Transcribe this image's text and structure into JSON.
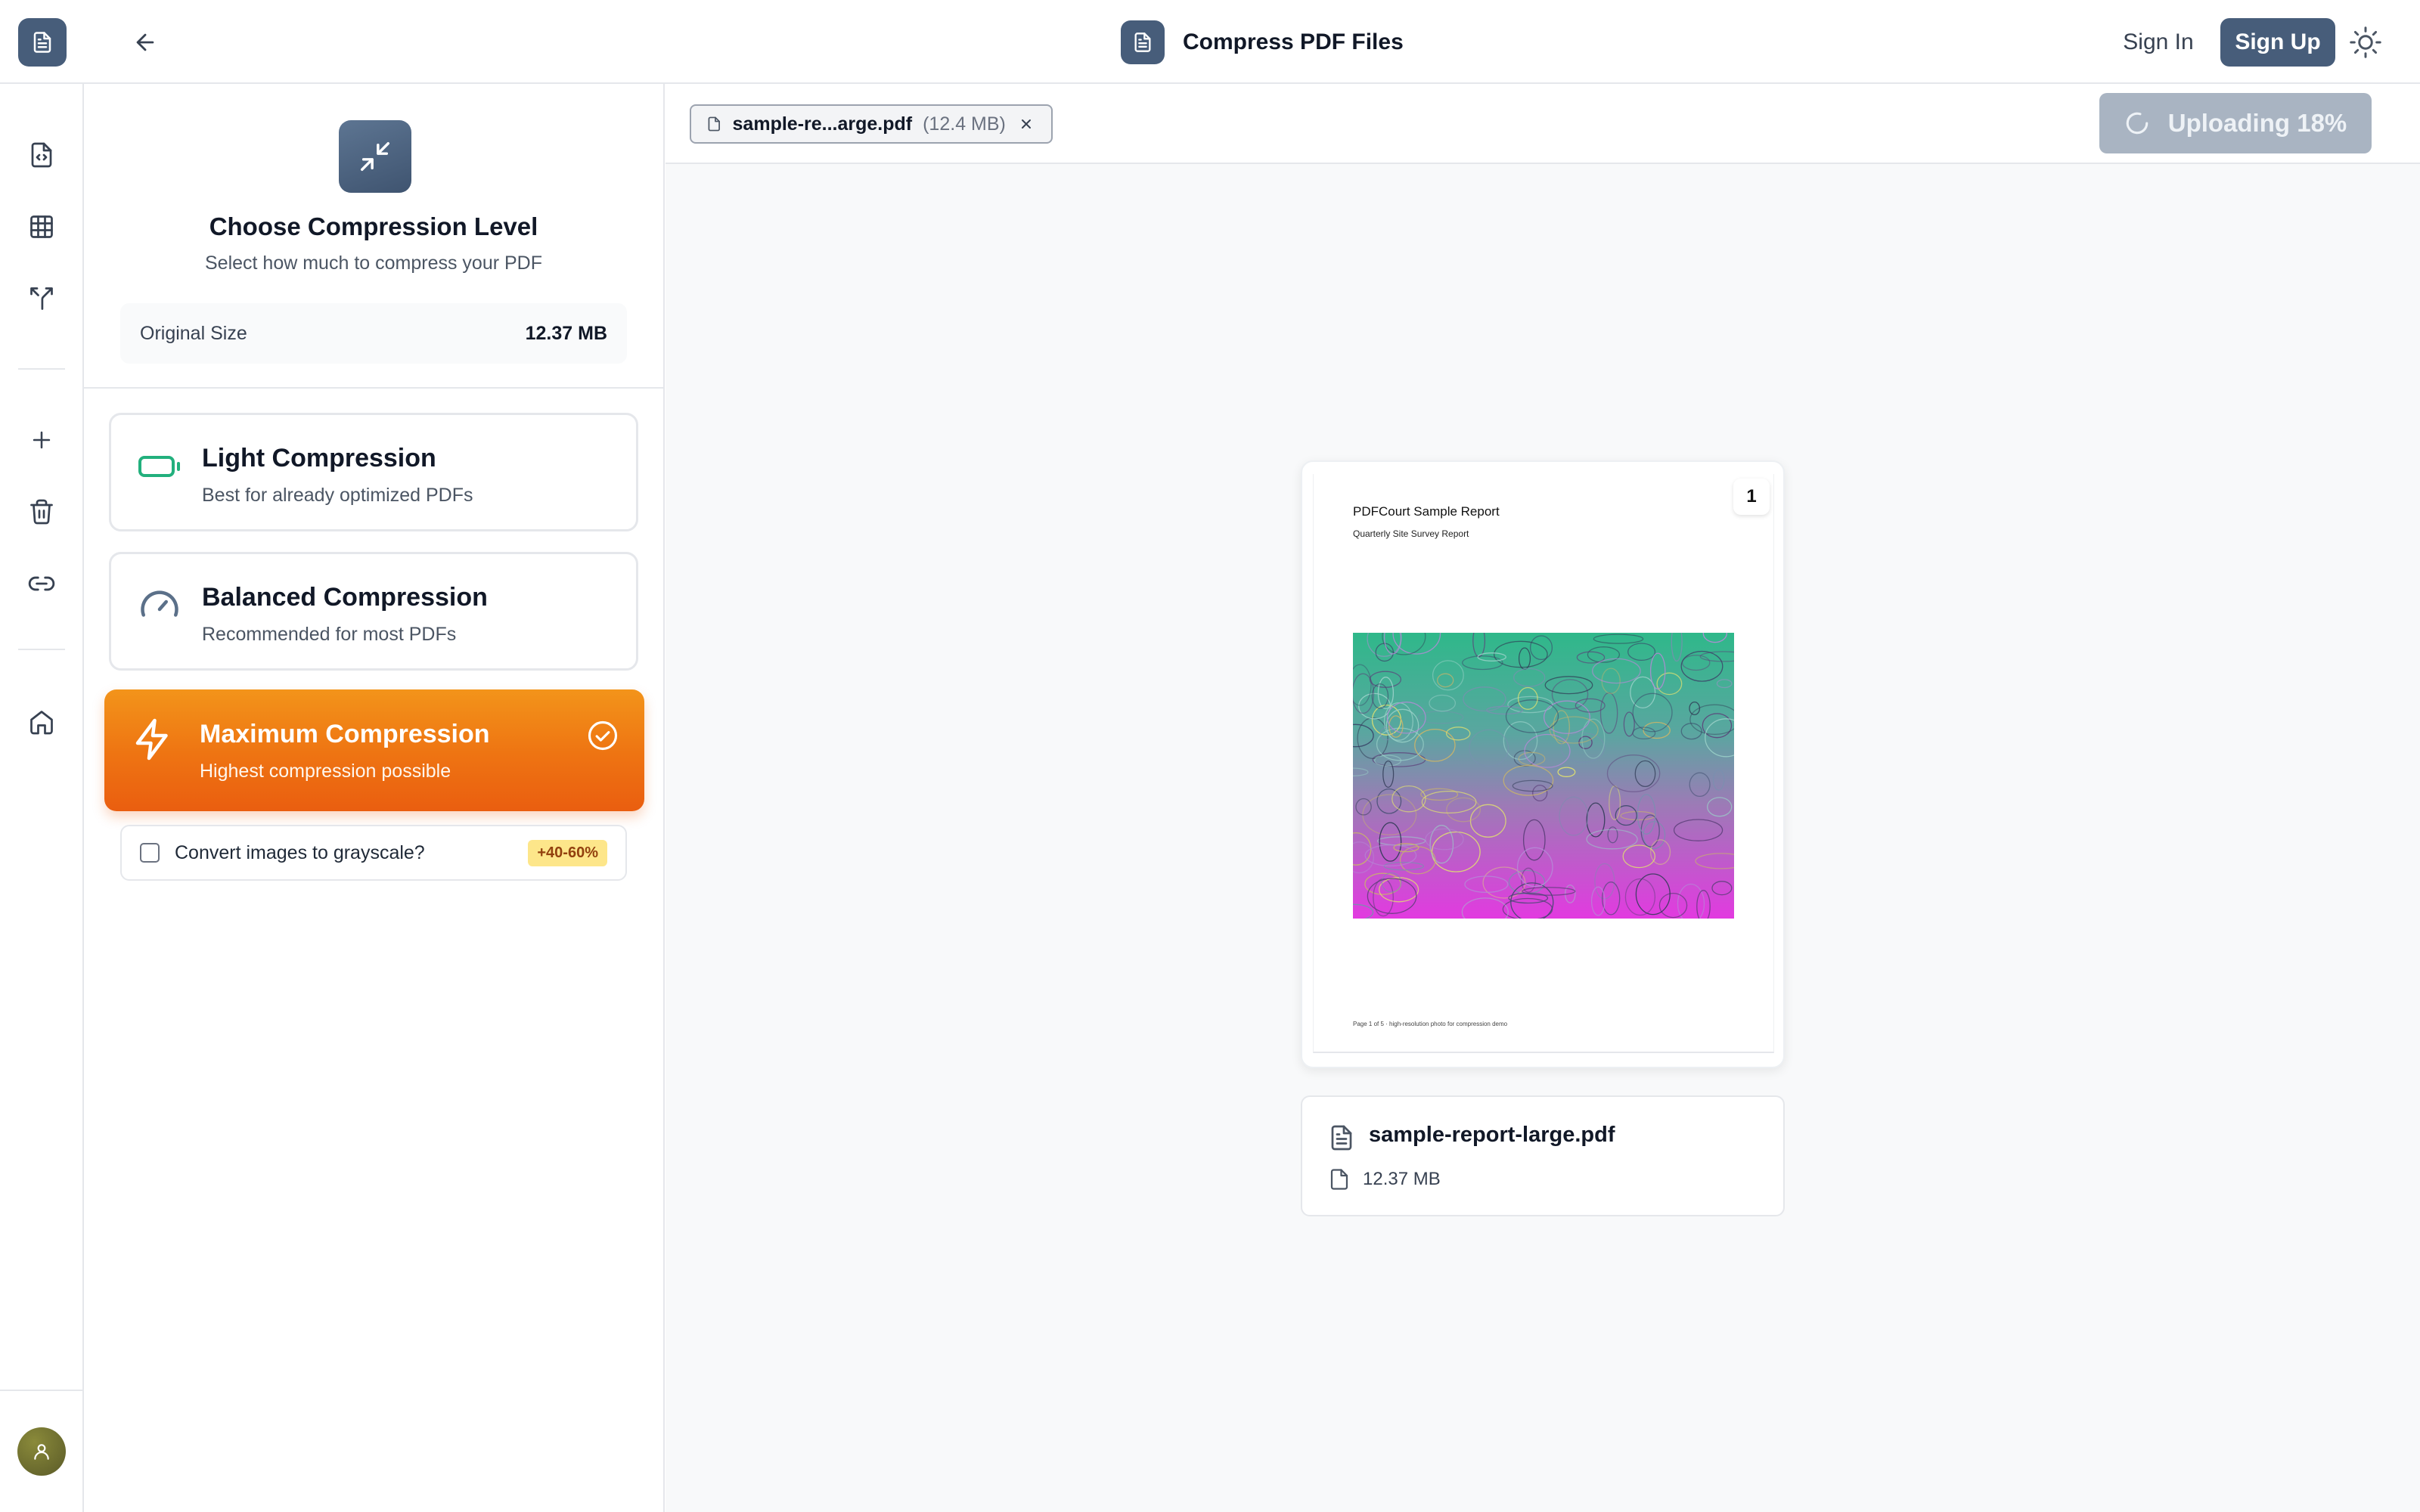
{
  "header": {
    "title": "Compress PDF Files",
    "sign_in": "Sign In",
    "sign_up": "Sign Up"
  },
  "sidebar": {
    "items": [
      {
        "icon": "file-code-icon"
      },
      {
        "icon": "grid-icon"
      },
      {
        "icon": "merge-arrows-icon"
      },
      {
        "icon": "plus-icon"
      },
      {
        "icon": "trash-icon"
      },
      {
        "icon": "link-icon"
      },
      {
        "icon": "home-icon"
      }
    ]
  },
  "panel": {
    "title": "Choose Compression Level",
    "subtitle": "Select how much to compress your PDF",
    "original_size_label": "Original Size",
    "original_size_value": "12.37 MB",
    "options": [
      {
        "name": "Light Compression",
        "desc": "Best for already optimized PDFs",
        "icon": "battery-icon",
        "selected": false
      },
      {
        "name": "Balanced Compression",
        "desc": "Recommended for most PDFs",
        "icon": "gauge-icon",
        "selected": false
      },
      {
        "name": "Maximum Compression",
        "desc": "Highest compression possible",
        "icon": "lightning-icon",
        "selected": true
      }
    ],
    "grayscale": {
      "label": "Convert images to grayscale?",
      "badge": "+40-60%",
      "checked": false
    }
  },
  "main": {
    "file_chip": {
      "name": "sample-re...arge.pdf",
      "size": "(12.4 MB)"
    },
    "upload_button": "Uploading 18%",
    "upload_progress": 0.18,
    "preview": {
      "doc_title": "PDFCourt Sample Report",
      "doc_subtitle": "Quarterly Site Survey Report",
      "doc_footer": "Page 1 of 5 · high-resolution photo for compression demo",
      "page_number": "1"
    },
    "file_info": {
      "name": "sample-report-large.pdf",
      "size": "12.37 MB"
    }
  },
  "colors": {
    "brand": "#475d7a",
    "accent_orange": "#ee7312",
    "light_green": "#22b07d",
    "badge_bg": "#fde68a"
  }
}
